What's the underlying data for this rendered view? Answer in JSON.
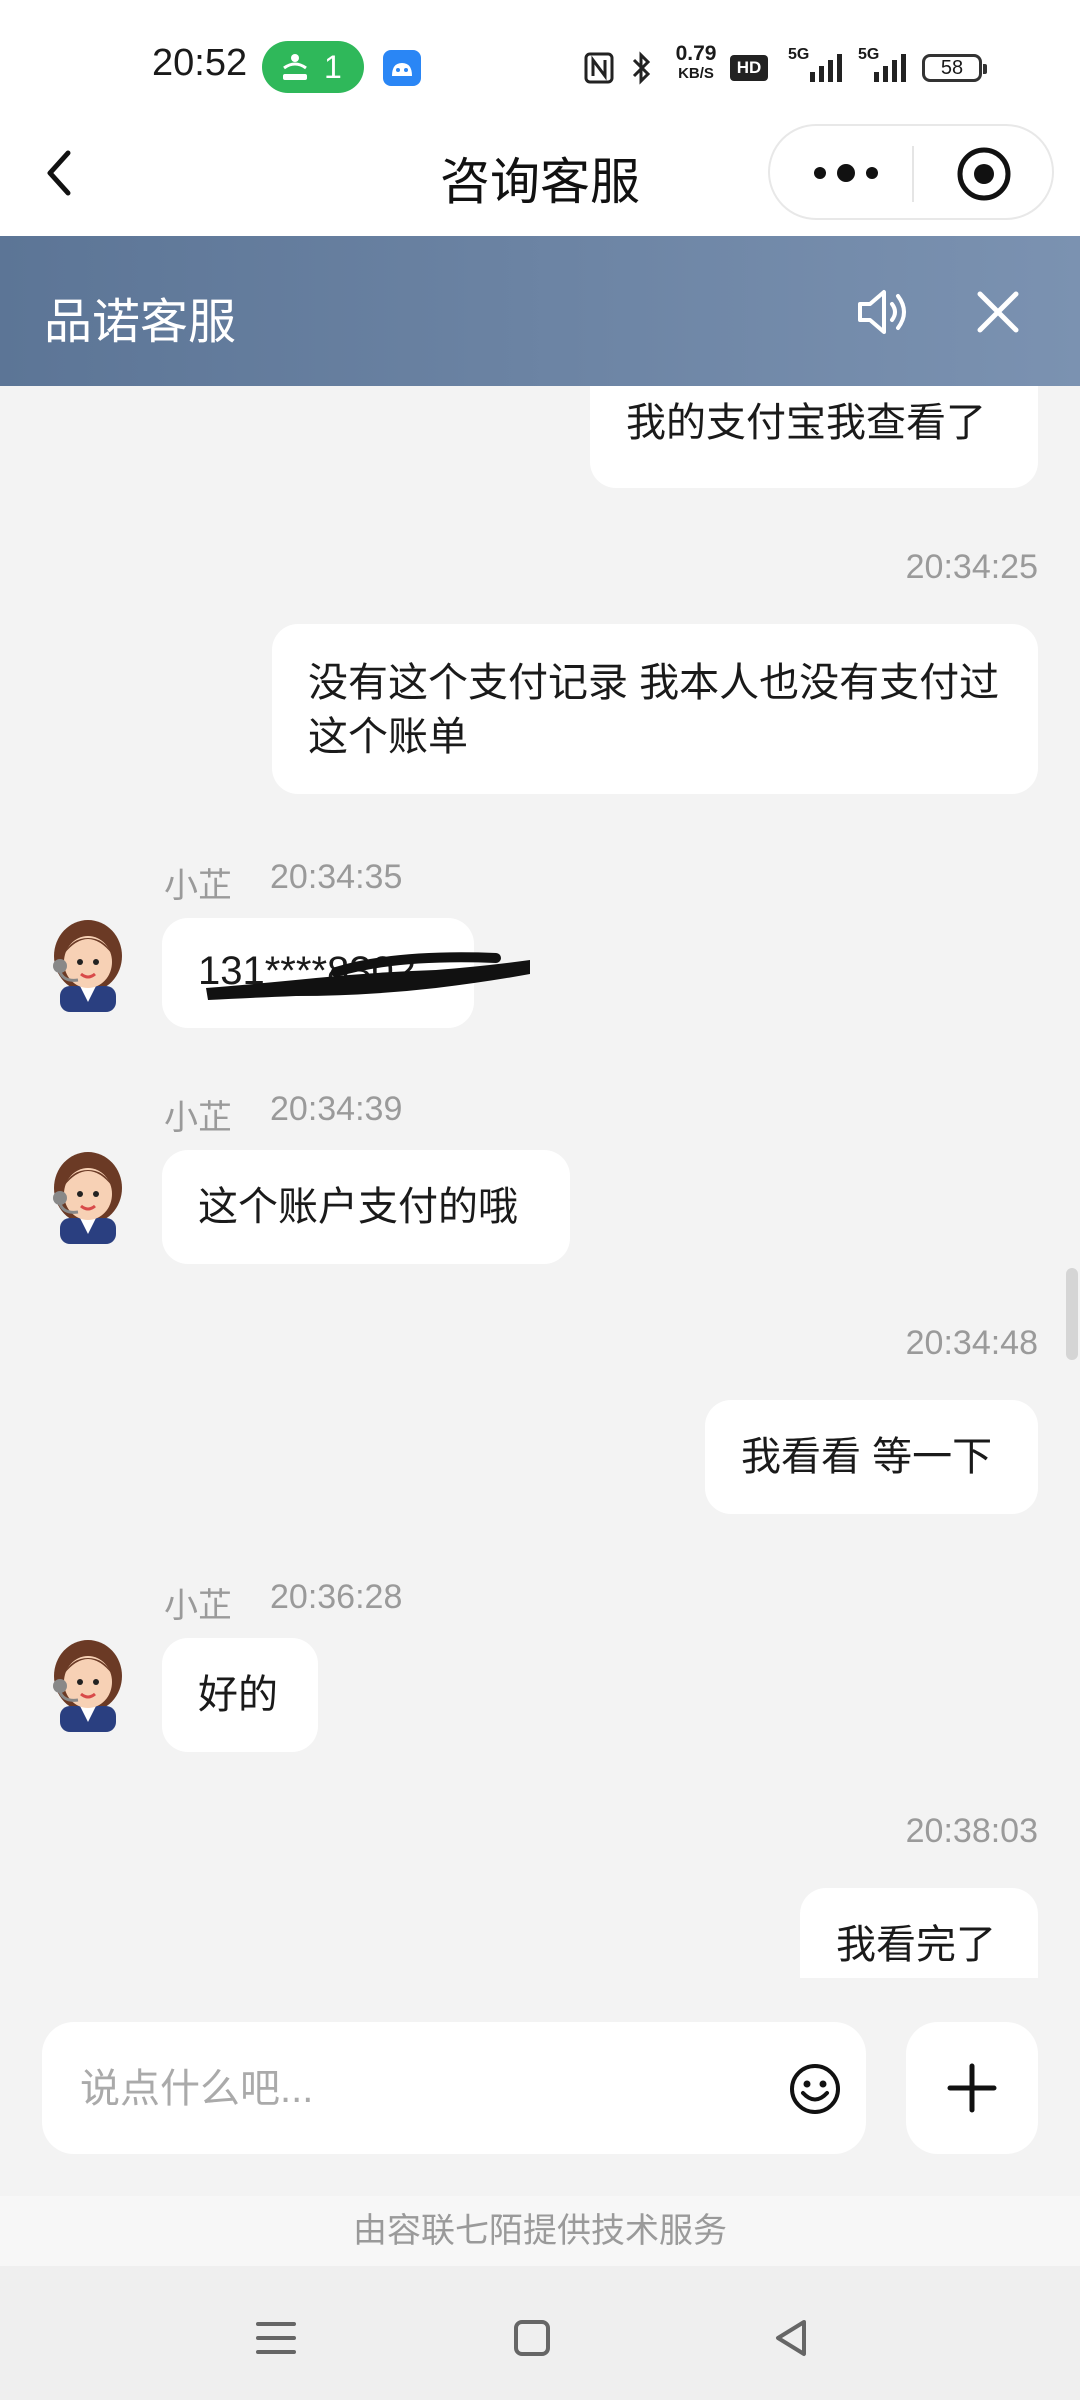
{
  "status_bar": {
    "time": "20:52",
    "hotspot_count": "1",
    "speed_value": "0.79",
    "speed_unit": "KB/S",
    "hd_label": "HD",
    "signal1_label": "5G",
    "signal2_label": "5G",
    "battery": "58"
  },
  "titlebar": {
    "title": "咨询客服"
  },
  "service_header": {
    "title": "品诺客服"
  },
  "chat": {
    "messages": [
      {
        "text": "我的支付宝我查看了"
      },
      {
        "time": "20:34:25",
        "text": "没有这个支付记录 我本人也没有支付过这个账单"
      },
      {
        "agent": "小芷",
        "time": "20:34:35",
        "text": "131****8302"
      },
      {
        "agent": "小芷",
        "time": "20:34:39",
        "text": "这个账户支付的哦"
      },
      {
        "time": "20:34:48",
        "text": "我看看 等一下"
      },
      {
        "agent": "小芷",
        "time": "20:36:28",
        "text": "好的"
      },
      {
        "time": "20:38:03",
        "text": "我看完了"
      }
    ]
  },
  "input": {
    "placeholder": "说点什么吧..."
  },
  "footer": {
    "text": "由容联七陌提供技术服务"
  },
  "colors": {
    "header_gradient_start": "#5c7596",
    "header_gradient_end": "#7b92b1",
    "hotspot_green": "#2fb85a",
    "background": "#f3f3f3"
  }
}
